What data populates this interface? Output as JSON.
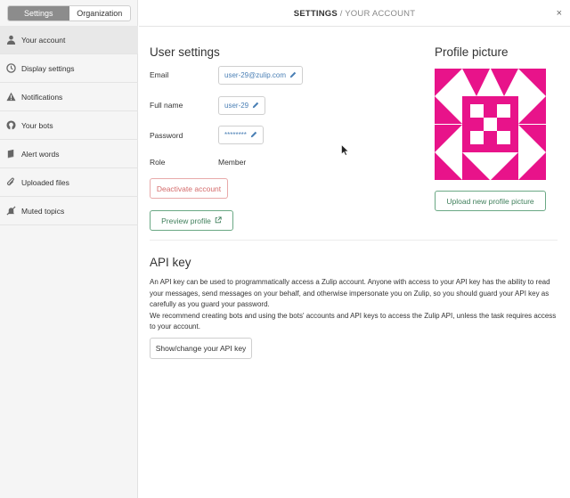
{
  "sidebar": {
    "tabs": [
      {
        "label": "Settings",
        "active": true
      },
      {
        "label": "Organization",
        "active": false
      }
    ],
    "items": [
      {
        "label": "Your account",
        "icon": "user-icon",
        "active": true
      },
      {
        "label": "Display settings",
        "icon": "clock-icon",
        "active": false
      },
      {
        "label": "Notifications",
        "icon": "warning-icon",
        "active": false
      },
      {
        "label": "Your bots",
        "icon": "github-icon",
        "active": false
      },
      {
        "label": "Alert words",
        "icon": "book-icon",
        "active": false
      },
      {
        "label": "Uploaded files",
        "icon": "paperclip-icon",
        "active": false
      },
      {
        "label": "Muted topics",
        "icon": "bell-slash-icon",
        "active": false
      }
    ]
  },
  "header": {
    "title_main": "SETTINGS",
    "title_sep": " / ",
    "title_sub": "YOUR ACCOUNT",
    "close": "×"
  },
  "user_settings": {
    "heading": "User settings",
    "email_label": "Email",
    "email_value": "user-29@zulip.com",
    "fullname_label": "Full name",
    "fullname_value": "user-29",
    "password_label": "Password",
    "password_value": "********",
    "role_label": "Role",
    "role_value": "Member",
    "deactivate_label": "Deactivate account",
    "preview_label": "Preview profile"
  },
  "profile_picture": {
    "heading": "Profile picture",
    "upload_label": "Upload new profile picture",
    "avatar_color": "#e8138a"
  },
  "api_key": {
    "heading": "API key",
    "paragraph1": "An API key can be used to programmatically access a Zulip account. Anyone with access to your API key has the ability to read your messages, send messages on your behalf, and otherwise impersonate you on Zulip, so you should guard your API key as carefully as you guard your password.",
    "paragraph2": "We recommend creating bots and using the bots' accounts and API keys to access the Zulip API, unless the task requires access to your account.",
    "button_label": "Show/change your API key"
  },
  "colors": {
    "accent_green": "#3f7f5b",
    "danger": "#d46b6b",
    "link_blue": "#4a7fb5"
  }
}
